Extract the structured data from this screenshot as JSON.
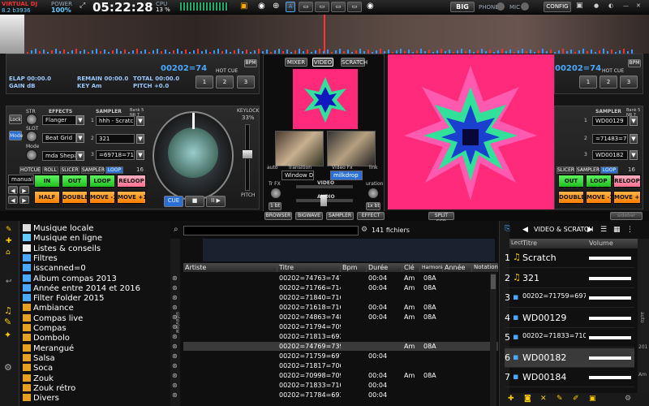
{
  "topbar": {
    "brand": "VIRTUAL DJ",
    "version": "8.2 b3936",
    "power_label": "POWER",
    "power_value": "100%",
    "clock": "05:22:28",
    "cpu_label": "CPU",
    "cpu_value": "13 %",
    "big_label": "BIG",
    "phone_label": "PHONE",
    "mic_label": "MIC",
    "config_label": "CONFIG",
    "badge": "A"
  },
  "deck_left": {
    "bpm": "00202=74",
    "bpm_btn": "BPM",
    "elap": "ELAP 00:00.0",
    "remain": "REMAIN 00:00.0",
    "total": "TOTAL 00:00.0",
    "gain": "GAIN dB",
    "key": "KEY Am",
    "pitch": "PITCH +0.0",
    "hot_cue": "HOT CUE",
    "hc": [
      "1",
      "2",
      "3"
    ],
    "effects_label": "EFFECTS",
    "str": "STR",
    "slot": "SLOT",
    "mode_label": "Mode",
    "lock": "Lock",
    "mode_btn": "Mode",
    "effect1": "Flanger",
    "effect2": "Beat Grid",
    "effect3": "mda Shepard",
    "sampler_label": "SAMPLER",
    "bank": "Bank 5 NR 7",
    "sample1": "hhh - Scratch",
    "sample2": "321",
    "sample3": "=69718=71607",
    "sidx": [
      "1",
      "2",
      "3"
    ],
    "keylock": "KEYLOCK",
    "keylock_val": "33%",
    "pitch_label": "PITCH",
    "tabs": [
      "HOTCUE",
      "ROLL",
      "SLICER",
      "SAMPLER",
      "LOOP",
      "16"
    ],
    "manual": "manual l",
    "pads": [
      "IN",
      "OUT",
      "LOOP",
      "RELOOP",
      "HALF",
      "DOUBLE",
      "MOVE -1 bt",
      "MOVE +1"
    ],
    "transport": [
      "CUE",
      "■",
      "II ▶"
    ]
  },
  "deck_right": {
    "bpm": "00202=74",
    "bpm_btn": "BPM",
    "hot_cue": "HOT CUE",
    "hc": [
      "1",
      "2",
      "3"
    ],
    "sampler_label": "SAMPLER",
    "bank": "Bank 5 NR 7",
    "sample1": "WD00129",
    "sample2": "=71483=70998",
    "sample3": "WD00182",
    "sidx": [
      "1",
      "2",
      "3"
    ],
    "tabs": [
      "SLICER",
      "SAMPLER",
      "LOOP",
      "16"
    ],
    "pads": [
      "OUT",
      "LOOP",
      "RELOOP",
      "DOUBLE",
      "MOVE -1 bt",
      "MOVE +1"
    ]
  },
  "center": {
    "tabs": [
      "MIXER",
      "VIDEO",
      "SCRATCH"
    ],
    "auto": "auto",
    "transition": "Transition",
    "video_fx": "Video Fx",
    "link": "link",
    "trans_val": "Window Doub",
    "fx_val": "milkdrop",
    "video": "VIDEO",
    "audio": "AUDIO",
    "tr_fx": "Tr FX",
    "duration": "uration",
    "beat_l": "1 bt",
    "beat_r": "1x bt"
  },
  "nav": {
    "browser": "BROWSER",
    "bigwave": "BIGWAVE",
    "sampler": "SAMPLER",
    "effect": "EFFECT",
    "split": "SPLIT SCR",
    "sidebar_right": "sidebar"
  },
  "tree": [
    "Musique locale",
    "Musique en ligne",
    "Listes & conseils",
    "Filtres",
    "isscanned=0",
    "Album compas 2013",
    "Année entre 2014 et 2016",
    "Filter Folder 2015",
    "Ambiance",
    "Compas live",
    "Compas",
    "Dombolo",
    "Merangué",
    "Salsa",
    "Soca",
    "Zouk",
    "Zouk rétro",
    "Divers"
  ],
  "browser": {
    "search_placeholder": "",
    "files": "141 fichiers",
    "side_label": "sideview",
    "columns": [
      "Artiste",
      "Titre",
      "Bpm",
      "Durée",
      "Clé",
      "Harmonique",
      "Année",
      "Notation"
    ],
    "rows": [
      {
        "titre": "00202=74763=74763",
        "duree": "00:04",
        "cle": "Am",
        "harm": "08A"
      },
      {
        "titre": "00202=71766=71477",
        "duree": "00:04",
        "cle": "Am",
        "harm": "08A"
      },
      {
        "titre": "00202=71840=71641",
        "duree": "",
        "cle": "",
        "harm": ""
      },
      {
        "titre": "00202=71618=71618",
        "duree": "00:04",
        "cle": "Am",
        "harm": "08A"
      },
      {
        "titre": "00202=74863=74863",
        "duree": "00:04",
        "cle": "Am",
        "harm": "08A"
      },
      {
        "titre": "00202=71794=70992",
        "duree": "",
        "cle": "",
        "harm": ""
      },
      {
        "titre": "00202=71813=69250",
        "duree": "",
        "cle": "",
        "harm": ""
      },
      {
        "titre": "00202=74769=73903=7",
        "duree": "",
        "cle": "Am",
        "harm": "08A"
      },
      {
        "titre": "00202=71759=69718",
        "duree": "00:04",
        "cle": "",
        "harm": ""
      },
      {
        "titre": "00202=71817=70688",
        "duree": "",
        "cle": "",
        "harm": ""
      },
      {
        "titre": "00202=70998=70998",
        "duree": "00:04",
        "cle": "Am",
        "harm": "08A"
      },
      {
        "titre": "00202=71833=71083",
        "duree": "00:04",
        "cle": "",
        "harm": ""
      },
      {
        "titre": "00202=71784=69379",
        "duree": "00:04",
        "cle": "",
        "harm": ""
      }
    ]
  },
  "sideview": {
    "title": "VIDEO & SCRATCH",
    "col_lect": "Lect",
    "col_titre": "Titre",
    "col_volume": "Volume",
    "side_tabs": [
      "auto",
      "201",
      "Am"
    ],
    "rows": [
      {
        "n": "1",
        "t": "Scratch"
      },
      {
        "n": "2",
        "t": "321"
      },
      {
        "n": "3",
        "t": "00202=71759=69718="
      },
      {
        "n": "4",
        "t": "WD00129"
      },
      {
        "n": "5",
        "t": "00202=71833=71083="
      },
      {
        "n": "6",
        "t": "WD00182"
      },
      {
        "n": "7",
        "t": "WD00184"
      }
    ]
  },
  "colors": {
    "accent": "#4aa8ff",
    "pad_green": "#3ee83e",
    "pad_orange": "#ff8c1a",
    "pad_pink": "#ff8fa8",
    "video_pink": "#ff2a7a",
    "video_green": "#33e09a",
    "video_blue": "#1018c0"
  }
}
